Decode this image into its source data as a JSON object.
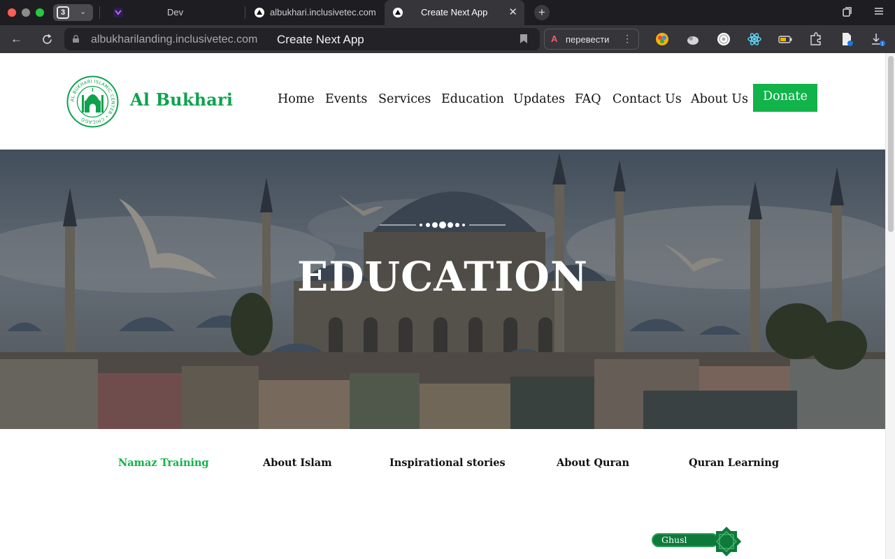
{
  "browser": {
    "tab_count": "3",
    "tabs": [
      {
        "label": "Dev"
      },
      {
        "label": "albukhari.inclusivetec.com"
      },
      {
        "label": "Create Next App"
      }
    ],
    "url": "albukharilanding.inclusivetec.com",
    "page_title": "Create Next App",
    "translate_label": "перевести",
    "download_badge": "1"
  },
  "site": {
    "brand": "Al Bukhari",
    "logo_text": "AL BUKHARI ISLAMIC CENTER • CHICAGO",
    "nav": [
      "Home",
      "Events",
      "Services",
      "Education",
      "Updates",
      "FAQ",
      "Contact Us",
      "About Us"
    ],
    "donate_label": "Donate"
  },
  "hero": {
    "title": "EDUCATION"
  },
  "education_tabs": {
    "items": [
      "Namaz Training",
      "About Islam",
      "Inspirational stories",
      "About Quran",
      "Quran Learning"
    ],
    "active": "Namaz Training"
  },
  "ghusl": {
    "label": "Ghusl"
  },
  "colors": {
    "brand_green": "#11b34a",
    "chrome_dark": "#1e1e22"
  }
}
